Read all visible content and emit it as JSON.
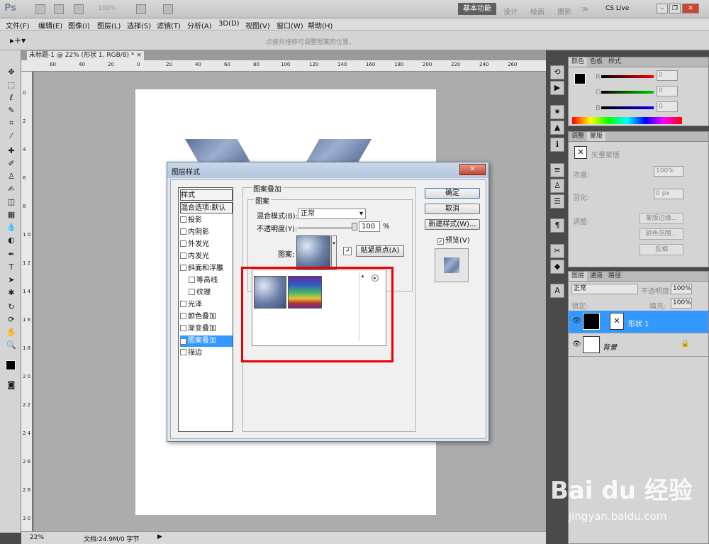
{
  "app": {
    "logo": "Ps",
    "zoom": "100%",
    "workspaces": {
      "active": "基本功能",
      "design": "设计",
      "paint": "绘画",
      "photo": "摄影",
      "more": "≫"
    },
    "cslive": "CS Live"
  },
  "menu": [
    "文件(F)",
    "编辑(E)",
    "图像(I)",
    "图层(L)",
    "选择(S)",
    "滤镜(T)",
    "分析(A)",
    "3D(D)",
    "视图(V)",
    "窗口(W)",
    "帮助(H)"
  ],
  "options": {
    "hint": "点按并拖移可调整图案的位置。"
  },
  "document": {
    "tab_title": "未标题-1 @ 22% (形状 1, RGB/8) *",
    "close": "×"
  },
  "ruler": {
    "h": [
      "60",
      "40",
      "20",
      "0",
      "20",
      "40",
      "60",
      "80",
      "100",
      "120",
      "140",
      "160",
      "180",
      "200",
      "220",
      "240",
      "260"
    ],
    "v": [
      "0",
      "2",
      "4",
      "6",
      "8",
      "1 0",
      "1 2",
      "1 4",
      "1 6",
      "1 8",
      "2 0",
      "2 2",
      "2 4",
      "2 6",
      "2 8",
      "3 0"
    ]
  },
  "status": {
    "zoom": "22%",
    "doc": "文档:24.9M/0 字节"
  },
  "color_panel": {
    "tabs": [
      "颜色",
      "色板",
      "样式"
    ],
    "r": "0",
    "g": "0",
    "b": "0",
    "r_label": "R",
    "g_label": "G",
    "b_label": "B"
  },
  "adjust_panel": {
    "tabs": [
      "调整",
      "蒙版"
    ],
    "title": "矢量蒙版",
    "density_label": "浓度:",
    "density": "100%",
    "feather_label": "羽化:",
    "feather": "0 px",
    "refine_label": "调整:",
    "buttons": [
      "蒙版边缘...",
      "颜色范围...",
      "反相"
    ]
  },
  "layers_panel": {
    "tabs": [
      "图层",
      "通道",
      "路径"
    ],
    "blend": "正常",
    "opacity_label": "不透明度:",
    "opacity": "100%",
    "lock_label": "锁定:",
    "fill_label": "填充:",
    "fill": "100%",
    "layers": [
      {
        "name": "形状 1",
        "selected": true
      },
      {
        "name": "背景",
        "selected": false
      }
    ]
  },
  "dialog": {
    "title": "图层样式",
    "close": "✕",
    "styles_header": "样式",
    "blend_defaults": "混合选项:默认",
    "styles": [
      {
        "label": "投影",
        "checked": false,
        "indent": false
      },
      {
        "label": "内阴影",
        "checked": false,
        "indent": false
      },
      {
        "label": "外发光",
        "checked": false,
        "indent": false
      },
      {
        "label": "内发光",
        "checked": false,
        "indent": false
      },
      {
        "label": "斜面和浮雕",
        "checked": false,
        "indent": false
      },
      {
        "label": "等高线",
        "checked": false,
        "indent": true
      },
      {
        "label": "纹理",
        "checked": false,
        "indent": true
      },
      {
        "label": "光泽",
        "checked": false,
        "indent": false
      },
      {
        "label": "颜色叠加",
        "checked": false,
        "indent": false
      },
      {
        "label": "渐变叠加",
        "checked": false,
        "indent": false
      },
      {
        "label": "图案叠加",
        "checked": true,
        "indent": false,
        "selected": true
      },
      {
        "label": "描边",
        "checked": false,
        "indent": false
      }
    ],
    "section_title": "图案叠加",
    "group_title": "图案",
    "blend_mode_label": "混合模式(B):",
    "blend_mode": "正常",
    "opacity_label": "不透明度(Y):",
    "opacity": "100",
    "percent": "%",
    "pattern_label": "图案:",
    "snap_origin": "贴紧原点(A)",
    "buttons": {
      "ok": "确定",
      "cancel": "取消",
      "new_style": "新建样式(W)...",
      "preview": "预览(V)"
    }
  },
  "watermark": {
    "main": "Bai du 经验",
    "url": "jingyan.baidu.com"
  }
}
